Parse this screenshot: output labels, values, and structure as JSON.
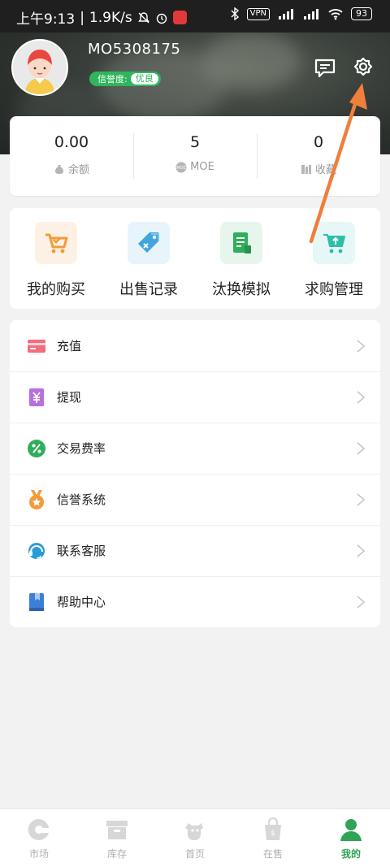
{
  "status_bar": {
    "time": "上午9:13",
    "speed": "1.9K/s",
    "vpn": "VPN",
    "battery": "93"
  },
  "profile": {
    "username": "MO5308175",
    "credit_label": "信誉度:",
    "credit_value": "优良"
  },
  "stats": [
    {
      "value": "0.00",
      "label": "余额",
      "icon": "money-bag-icon"
    },
    {
      "value": "5",
      "label": "MOE",
      "icon": "moe-coin-icon"
    },
    {
      "value": "0",
      "label": "收藏",
      "icon": "collection-icon"
    }
  ],
  "quick_actions": [
    {
      "label": "我的购买",
      "icon": "cart-check-icon"
    },
    {
      "label": "出售记录",
      "icon": "price-tag-icon"
    },
    {
      "label": "汰换模拟",
      "icon": "document-list-icon"
    },
    {
      "label": "求购管理",
      "icon": "cart-up-icon"
    }
  ],
  "menu": [
    {
      "label": "充值",
      "icon": "card-icon"
    },
    {
      "label": "提现",
      "icon": "yuan-icon"
    },
    {
      "label": "交易费率",
      "icon": "percent-icon"
    },
    {
      "label": "信誉系统",
      "icon": "medal-icon"
    },
    {
      "label": "联系客服",
      "icon": "headset-icon"
    },
    {
      "label": "帮助中心",
      "icon": "book-icon"
    }
  ],
  "tabs": [
    {
      "label": "市场",
      "icon": "market-icon",
      "active": false
    },
    {
      "label": "库存",
      "icon": "inventory-icon",
      "active": false
    },
    {
      "label": "首页",
      "icon": "home-icon",
      "active": false
    },
    {
      "label": "在售",
      "icon": "on-sale-icon",
      "active": false
    },
    {
      "label": "我的",
      "icon": "profile-icon",
      "active": true
    }
  ],
  "colors": {
    "accent_green": "#2fb55c",
    "annotation_arrow": "#f07f3c"
  }
}
